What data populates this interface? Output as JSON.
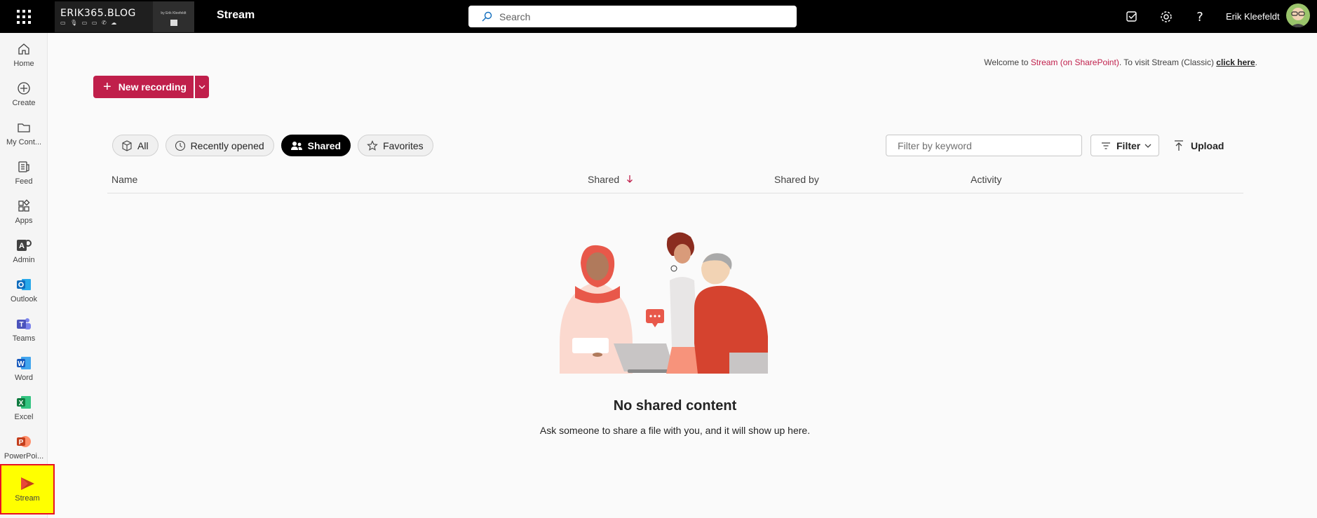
{
  "topbar": {
    "brand_title": "ERIK365.BLOG",
    "brand_icons": "▭ 🎙 ▭ ▭ ✆ ☁",
    "brand_sub": "by Erik Kleefeldt",
    "app_title": "Stream",
    "search_placeholder": "Search",
    "user_name": "Erik Kleefeldt"
  },
  "rail": {
    "items": [
      {
        "label": "Home",
        "icon": "home-icon"
      },
      {
        "label": "Create",
        "icon": "plus-circle-icon"
      },
      {
        "label": "My Cont...",
        "icon": "folder-icon"
      },
      {
        "label": "Feed",
        "icon": "feed-icon"
      },
      {
        "label": "Apps",
        "icon": "apps-icon"
      },
      {
        "label": "Admin",
        "icon": "admin-icon"
      },
      {
        "label": "Outlook",
        "icon": "outlook-icon"
      },
      {
        "label": "Teams",
        "icon": "teams-icon"
      },
      {
        "label": "Word",
        "icon": "word-icon"
      },
      {
        "label": "Excel",
        "icon": "excel-icon"
      },
      {
        "label": "PowerPoi...",
        "icon": "powerpoint-icon"
      },
      {
        "label": "Stream",
        "icon": "stream-icon"
      }
    ]
  },
  "welcome": {
    "prefix": "Welcome to ",
    "highlight": "Stream (on SharePoint)",
    "middle": ". To visit Stream (Classic) ",
    "link": "click here",
    "suffix": "."
  },
  "new_recording_label": "New recording",
  "pills": [
    {
      "label": "All",
      "icon": "cube-icon",
      "active": false
    },
    {
      "label": "Recently opened",
      "icon": "clock-icon",
      "active": false
    },
    {
      "label": "Shared",
      "icon": "people-icon",
      "active": true
    },
    {
      "label": "Favorites",
      "icon": "star-icon",
      "active": false
    }
  ],
  "filter_placeholder": "Filter by keyword",
  "filter_label": "Filter",
  "upload_label": "Upload",
  "columns": [
    "Name",
    "Shared",
    "Shared by",
    "Activity"
  ],
  "empty_title": "No shared content",
  "empty_subtitle": "Ask someone to share a file with you, and it will show up here.",
  "colors": {
    "brand": "#c01f4b",
    "topbar": "#000000",
    "highlight": "#ffff00"
  }
}
